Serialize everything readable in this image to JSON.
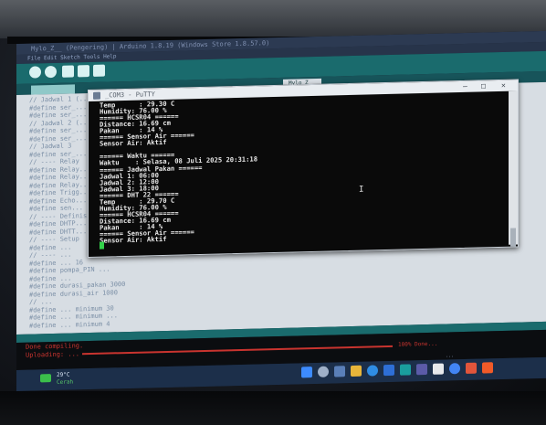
{
  "ide": {
    "title": "Mylo_Z__ (Pengering) | Arduino 1.8.19 (Windows Store 1.8.57.0)",
    "menu": "File  Edit  Sketch  Tools  Help",
    "tabs": [
      "",
      "Mylo_Z"
    ],
    "code_lines": [
      "// Jadwal 1 (...",
      "#define  ser_...",
      "#define  ser_...",
      "// Jadwal 2 (...",
      "#define  ser_...",
      "#define  ser_...",
      "// Jadwal 3",
      "#define  ser_...",
      "// ---- Relay",
      "#define  Relay...",
      "#define  Relay...",
      "#define  Relay...",
      "#define  Trigg...",
      "#define  Echo...",
      "#define  sen...",
      "// ---- Definisi",
      "#define  DHTP...",
      "#define  DHTT...",
      "// ---- Setup",
      "#define  ...",
      "// ---- ...",
      "#define  ...  16",
      "#define  pompa_PIN     ...",
      "#define  ...",
      "#define  durasi_pakan  3000",
      "#define  durasi_air   1000",
      "// ...",
      "#define  ...  minimum 30",
      "#define  ...  minimum ...",
      "#define  ...  minimum 4"
    ],
    "console_lines": [
      "Done compiling.",
      "Uploading: ..."
    ],
    "progress_label": "100% Done..."
  },
  "putty": {
    "title": "_COM3 - PuTTY",
    "lines": [
      "Temp      : 29.30 C",
      "Humidity: 76.00 %",
      "====== HCSR04 ======",
      "Distance: 16.69 cm",
      "Pakan     : 14 %",
      "====== Sensor Air ======",
      "Sensor Air: Aktif",
      "",
      "====== Waktu ======",
      "Waktu    : Selasa, 08 Juli 2025 20:31:18",
      "====== Jadwal Pakan ======",
      "Jadwal 1: 06:00",
      "Jadwal 2: 12:00",
      "Jadwal 3: 18:00",
      "====== DHT 22 ======",
      "Temp      : 29.70 C",
      "Humidity: 76.00 %",
      "====== HCSR04 ======",
      "Distance: 16.69 cm",
      "Pakan     : 14 %",
      "====== Sensor Air ======",
      "Sensor Air: Aktif"
    ],
    "mouse_char": "I"
  },
  "taskbar": {
    "weather_temp": "29°C",
    "weather_desc": "Cerah",
    "status_right": "..."
  },
  "colors": {
    "ide_teal": "#1a6b6d",
    "terminal_bg": "#0a0a0a",
    "terminal_text": "#e8e8e8",
    "console_red": "#c9342f",
    "taskbar": "#1c2f4a"
  }
}
